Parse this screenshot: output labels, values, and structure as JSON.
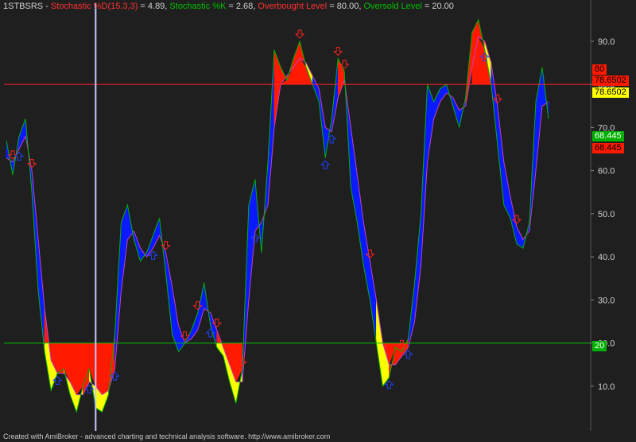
{
  "legend": {
    "ticker": "1STBSRS",
    "sep": " - ",
    "d_label": "Stochastic %D(15,3,3)",
    "d_value": " = 4.89, ",
    "k_label": "Stochastic %K",
    "k_value": " = 2.68, ",
    "ob_label": "Overbought Level",
    "ob_value": " = 80.00, ",
    "os_label": "Oversold Level",
    "os_value": " = 20.00"
  },
  "footer": "Created with AmiBroker - advanced charting and technical analysis software. http://www.amibroker.com",
  "colors": {
    "background": "#1f1f1f",
    "up_fill": "#0a1aff",
    "down_fill": "#0a1aff",
    "overbought_fill": "#ff1a00",
    "yellow_fill": "#ffff00",
    "k_line": "#00b000",
    "d_line": "#c040c0",
    "level_ob": "#ff2020",
    "level_os": "#00c000",
    "cursor": "#c8c8ff",
    "axis_text": "#d0d0d0",
    "ticker_text": "#d0d0d0",
    "d_text": "#ff3030",
    "k_text": "#00c000",
    "ob_text": "#ff3030",
    "os_text": "#00c000"
  },
  "badges": {
    "ob_level": "80",
    "ob_value": "78.6502",
    "ob_value_yellow": "78.6502",
    "k_last": "68.445",
    "d_last": "68.445",
    "os_level": "20"
  },
  "chart_data": {
    "type": "line",
    "y_ticks": [
      "10.0",
      "20.0",
      "30.0",
      "40.0",
      "50.0",
      "60.0",
      "70.0",
      "80.0",
      "90.0"
    ],
    "ylim": [
      0,
      97
    ],
    "levels": {
      "overbought": 80,
      "oversold": 20
    },
    "cursor_bar": 14,
    "series": [
      {
        "name": "Stochastic %K",
        "values": [
          67,
          59,
          68,
          72,
          55,
          32,
          18,
          9,
          13,
          14,
          8,
          4,
          10,
          14,
          5,
          4,
          8,
          22,
          48,
          52,
          44,
          39,
          41,
          45,
          49,
          36,
          22,
          18,
          20,
          23,
          27,
          34,
          24,
          19,
          17,
          11,
          6,
          14,
          52,
          58,
          41,
          62,
          88,
          84,
          81,
          86,
          90,
          84,
          80,
          76,
          63,
          72,
          86,
          83,
          56,
          48,
          38,
          30,
          20,
          10,
          12,
          19,
          18,
          21,
          34,
          50,
          80,
          76,
          79,
          80,
          75,
          70,
          77,
          92,
          95,
          88,
          80,
          66,
          52,
          49,
          43,
          42,
          48,
          76,
          84,
          72
        ]
      },
      {
        "name": "Stochastic %D(15,3,3)",
        "values": [
          63,
          62,
          65,
          68,
          60,
          44,
          28,
          16,
          13,
          13,
          11,
          8,
          8,
          11,
          10,
          8,
          9,
          14,
          32,
          44,
          46,
          42,
          40,
          42,
          45,
          41,
          33,
          24,
          20,
          21,
          23,
          28,
          27,
          23,
          19,
          15,
          11,
          11,
          30,
          46,
          48,
          52,
          70,
          80,
          82,
          84,
          86,
          85,
          82,
          79,
          70,
          69,
          77,
          81,
          70,
          59,
          48,
          39,
          30,
          20,
          15,
          15,
          17,
          19,
          25,
          38,
          62,
          72,
          76,
          78,
          77,
          74,
          75,
          84,
          91,
          90,
          85,
          75,
          62,
          54,
          47,
          44,
          46,
          60,
          75,
          76
        ]
      }
    ],
    "sell_arrows": [
      1,
      4,
      25,
      28,
      30,
      33,
      37,
      46,
      52,
      53,
      57,
      62,
      77,
      80,
      93,
      95,
      97,
      98,
      102,
      106,
      112,
      119
    ],
    "buy_arrows": [
      2,
      8,
      13,
      17,
      23,
      32,
      39,
      50,
      51,
      60,
      63,
      75,
      88,
      91
    ]
  }
}
